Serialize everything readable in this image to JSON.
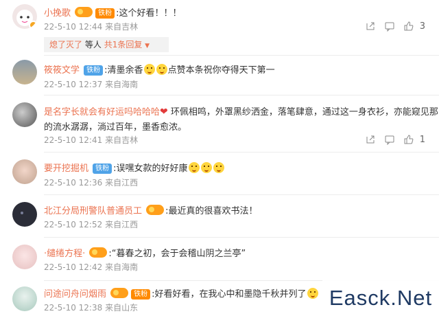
{
  "comments": [
    {
      "user": "小挽歌",
      "badge": "",
      "text": "这个好看！！！",
      "date": "22-5-10 12:44",
      "from": "来自吉林",
      "likes": "3"
    },
    {
      "user": "筱筱文学",
      "badge": "铁粉",
      "text_a": "清墨余香",
      "text_b": "点赞本条祝你夺得天下第一",
      "date": "22-5-10 12:37",
      "from": "来自海南",
      "likes": ""
    },
    {
      "user": "是名字长就会有好运吗哈哈哈",
      "text_a": "环佩相鸣，外罩黑纱洒金，落笔肆意，通过这一身衣衫，亦能窥见那日",
      "text_b": "的流水潺潺，淌过百年，墨香愈浓。",
      "date": "22-5-10 12:41",
      "from": "来自吉林",
      "likes": "1"
    },
    {
      "user": "要开挖掘机",
      "badge": "铁粉",
      "text": "误嘿女款的好好康",
      "date": "22-5-10 12:36",
      "from": "来自江西",
      "likes": ""
    },
    {
      "user": "北江分局刑警队普通员工",
      "text": "最近真的很喜欢书法！",
      "date": "22-5-10 12:52",
      "from": "来自江西",
      "likes": ""
    },
    {
      "user": "·缱绻方程·",
      "text": "“暮春之初，会于会稽山阴之兰亭”",
      "date": "22-5-10 12:42",
      "from": "来自海南",
      "likes": ""
    },
    {
      "user": "问途问舟问烟雨",
      "text": "好看好看，在我心中和墨隐千秋并列了",
      "date": "22-5-10 12:38",
      "from": "来自山东",
      "likes": ""
    }
  ],
  "reply": {
    "name": "熄了灭了",
    "suffix": "等人",
    "link": "共1条回复"
  },
  "watermark": "Easck.Net"
}
